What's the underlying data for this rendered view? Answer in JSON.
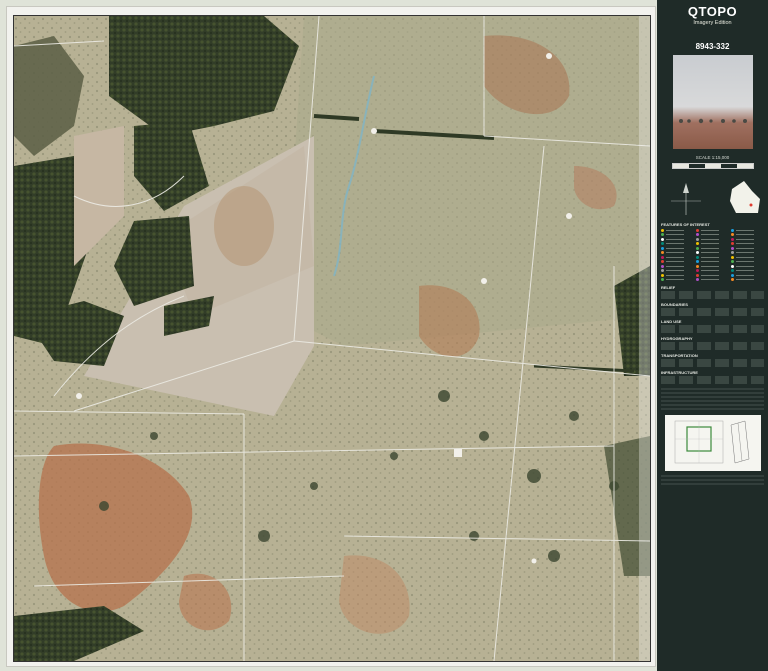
{
  "header": {
    "title": "QTOPO",
    "subtitle": "Imagery Edition",
    "sheet_number": "8943-332",
    "scale": "SCALE 1:15,000"
  },
  "legend": {
    "points_heading": "FEATURES OF INTEREST",
    "points_colors": [
      "#f0c000",
      "#e03c31",
      "#1aa0e0",
      "#4caf50",
      "#b04fc9",
      "#f48a24",
      "#ffffff",
      "#9e9e9e",
      "#c2185b",
      "#00897b"
    ],
    "sections": [
      "RELIEF",
      "BOUNDARIES",
      "LAND USE",
      "HYDROGRAPHY",
      "TRANSPORTATION",
      "INFRASTRUCTURE"
    ]
  },
  "map_colors": {
    "pasture": "#b9b49a",
    "forest": "#38442c",
    "bare_red": "#b87a55",
    "cleared": "#cbbfae",
    "fence": "#e8e6df",
    "creek": "#7fb4c6"
  }
}
